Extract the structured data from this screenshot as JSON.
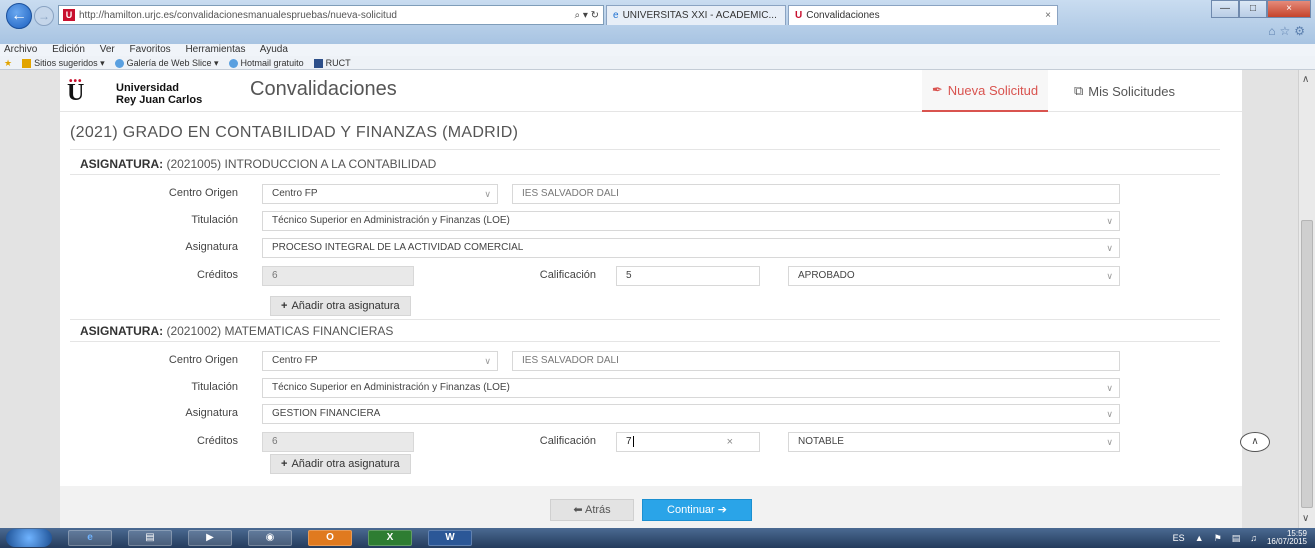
{
  "browser": {
    "url": "http://hamilton.urjc.es/convalidacionesmanualespruebas/nueva-solicitud",
    "url_host": "hamilton.urjc.es",
    "address_tools": "⌕ ▾ ↻",
    "tabs": [
      {
        "label": "UNIVERSITAS XXI - ACADEMIC..."
      },
      {
        "label": "Convalidaciones"
      }
    ],
    "menu": [
      "Archivo",
      "Edición",
      "Ver",
      "Favoritos",
      "Herramientas",
      "Ayuda"
    ],
    "favorites": [
      "Sitios sugeridos ▾",
      "Galería de Web Slice ▾",
      "Hotmail gratuito",
      "RUCT"
    ]
  },
  "header": {
    "university_line1": "Universidad",
    "university_line2": "Rey Juan Carlos",
    "app_title": "Convalidaciones",
    "nav_new": "Nueva Solicitud",
    "nav_mine": "Mis Solicitudes"
  },
  "degree": "(2021) GRADO EN CONTABILIDAD Y FINANZAS (MADRID)",
  "labels": {
    "centro_origen": "Centro Origen",
    "titulacion": "Titulación",
    "asignatura": "Asignatura",
    "creditos": "Créditos",
    "calificacion": "Calificación",
    "subject_prefix": "ASIGNATURA:",
    "add_subject": "Añadir otra asignatura"
  },
  "subjects": [
    {
      "code_name": "(2021005) INTRODUCCION A LA CONTABILIDAD",
      "centro_tipo": "Centro FP",
      "centro_nombre": "IES SALVADOR DALI",
      "titulacion": "Técnico Superior en Administración y Finanzas (LOE)",
      "asignatura": "PROCESO INTEGRAL DE LA ACTIVIDAD COMERCIAL",
      "creditos": "6",
      "calificacion": "5",
      "calificacion_texto": "APROBADO"
    },
    {
      "code_name": "(2021002) MATEMATICAS FINANCIERAS",
      "centro_tipo": "Centro FP",
      "centro_nombre": "IES SALVADOR DALI",
      "titulacion": "Técnico Superior en Administración y Finanzas (LOE)",
      "asignatura": "GESTION FINANCIERA",
      "creditos": "6",
      "calificacion": "7",
      "calificacion_texto": "NOTABLE"
    }
  ],
  "footer": {
    "back": "⬅ Atrás",
    "continue": "Continuar ➔"
  },
  "taskbar": {
    "lang": "ES",
    "time": "15:59",
    "date": "16/07/2015"
  },
  "colors": {
    "accent_red": "#d9534f",
    "primary_blue": "#2aa4e8"
  }
}
